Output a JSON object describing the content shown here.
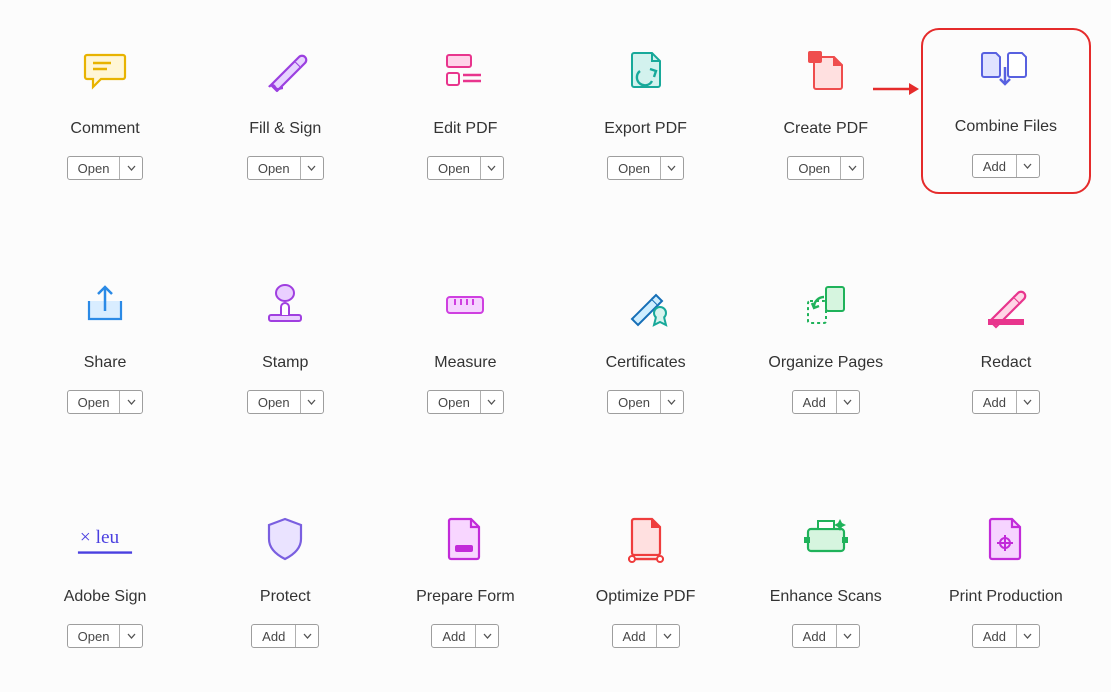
{
  "tools": [
    {
      "label": "Comment",
      "button": "Open",
      "icon": "comment",
      "highlighted": false
    },
    {
      "label": "Fill & Sign",
      "button": "Open",
      "icon": "fill-sign",
      "highlighted": false
    },
    {
      "label": "Edit PDF",
      "button": "Open",
      "icon": "edit-pdf",
      "highlighted": false
    },
    {
      "label": "Export PDF",
      "button": "Open",
      "icon": "export-pdf",
      "highlighted": false
    },
    {
      "label": "Create PDF",
      "button": "Open",
      "icon": "create-pdf",
      "highlighted": false
    },
    {
      "label": "Combine Files",
      "button": "Add",
      "icon": "combine-files",
      "highlighted": true
    },
    {
      "label": "Share",
      "button": "Open",
      "icon": "share",
      "highlighted": false
    },
    {
      "label": "Stamp",
      "button": "Open",
      "icon": "stamp",
      "highlighted": false
    },
    {
      "label": "Measure",
      "button": "Open",
      "icon": "measure",
      "highlighted": false
    },
    {
      "label": "Certificates",
      "button": "Open",
      "icon": "certificates",
      "highlighted": false
    },
    {
      "label": "Organize Pages",
      "button": "Add",
      "icon": "organize-pages",
      "highlighted": false
    },
    {
      "label": "Redact",
      "button": "Add",
      "icon": "redact",
      "highlighted": false
    },
    {
      "label": "Adobe Sign",
      "button": "Open",
      "icon": "adobe-sign",
      "highlighted": false
    },
    {
      "label": "Protect",
      "button": "Add",
      "icon": "protect",
      "highlighted": false
    },
    {
      "label": "Prepare Form",
      "button": "Add",
      "icon": "prepare-form",
      "highlighted": false
    },
    {
      "label": "Optimize PDF",
      "button": "Add",
      "icon": "optimize-pdf",
      "highlighted": false
    },
    {
      "label": "Enhance Scans",
      "button": "Add",
      "icon": "enhance-scans",
      "highlighted": false
    },
    {
      "label": "Print Production",
      "button": "Add",
      "icon": "print-prod",
      "highlighted": false
    }
  ]
}
